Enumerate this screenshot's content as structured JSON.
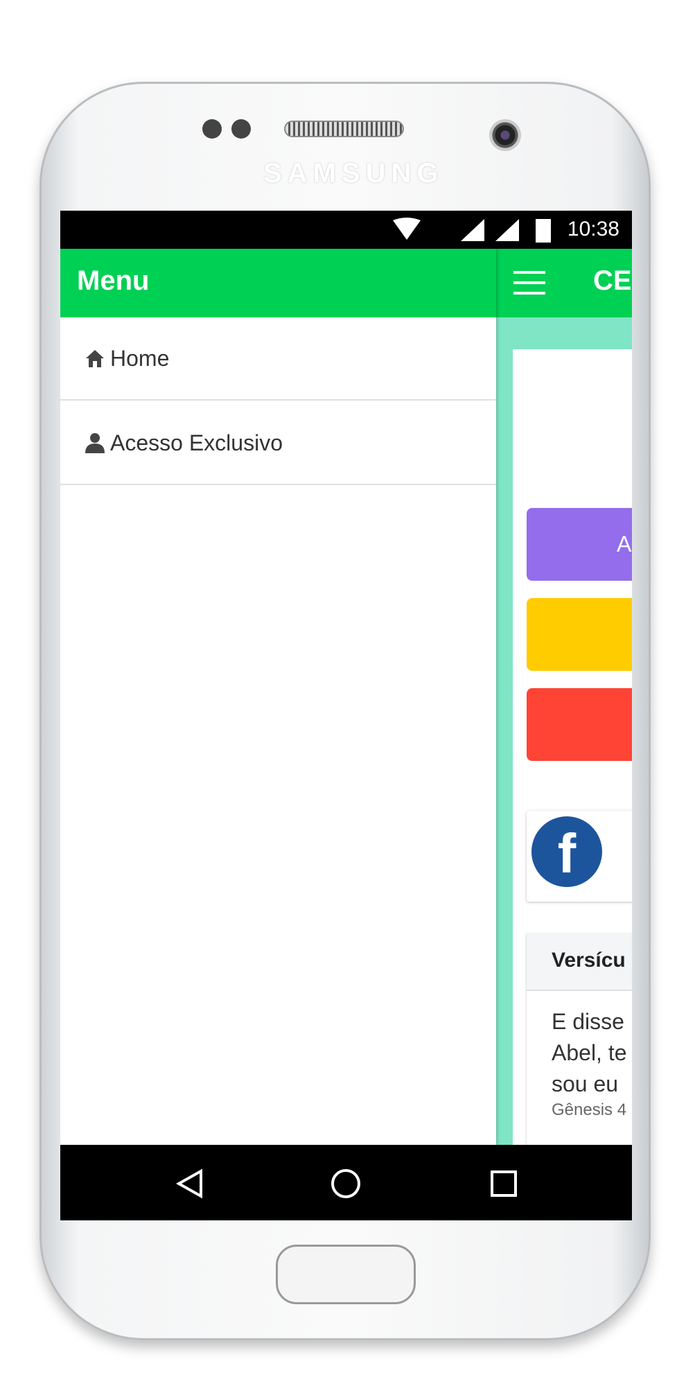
{
  "device": {
    "brand": "SAMSUNG"
  },
  "status_bar": {
    "time": "10:38",
    "icons": [
      "wifi-icon",
      "signal-icon",
      "signal-icon",
      "battery-icon"
    ]
  },
  "drawer": {
    "title": "Menu",
    "items": [
      {
        "label": "Home",
        "icon": "home-icon"
      },
      {
        "label": "Acesso Exclusivo",
        "icon": "user-icon"
      }
    ]
  },
  "main": {
    "title": "CE",
    "buttons": [
      {
        "label": "A",
        "color": "#936deb"
      },
      {
        "label": "",
        "color": "#ffcc00"
      },
      {
        "label": "",
        "color": "#ff4436"
      }
    ],
    "social": {
      "facebook_color": "#1d559d"
    },
    "verse": {
      "header": "Versícu",
      "lines": [
        "E disse",
        "Abel, te",
        "sou eu"
      ],
      "reference": "Gênesis 4"
    }
  },
  "colors": {
    "primary": "#00d054",
    "background": "#7fe5c5"
  }
}
